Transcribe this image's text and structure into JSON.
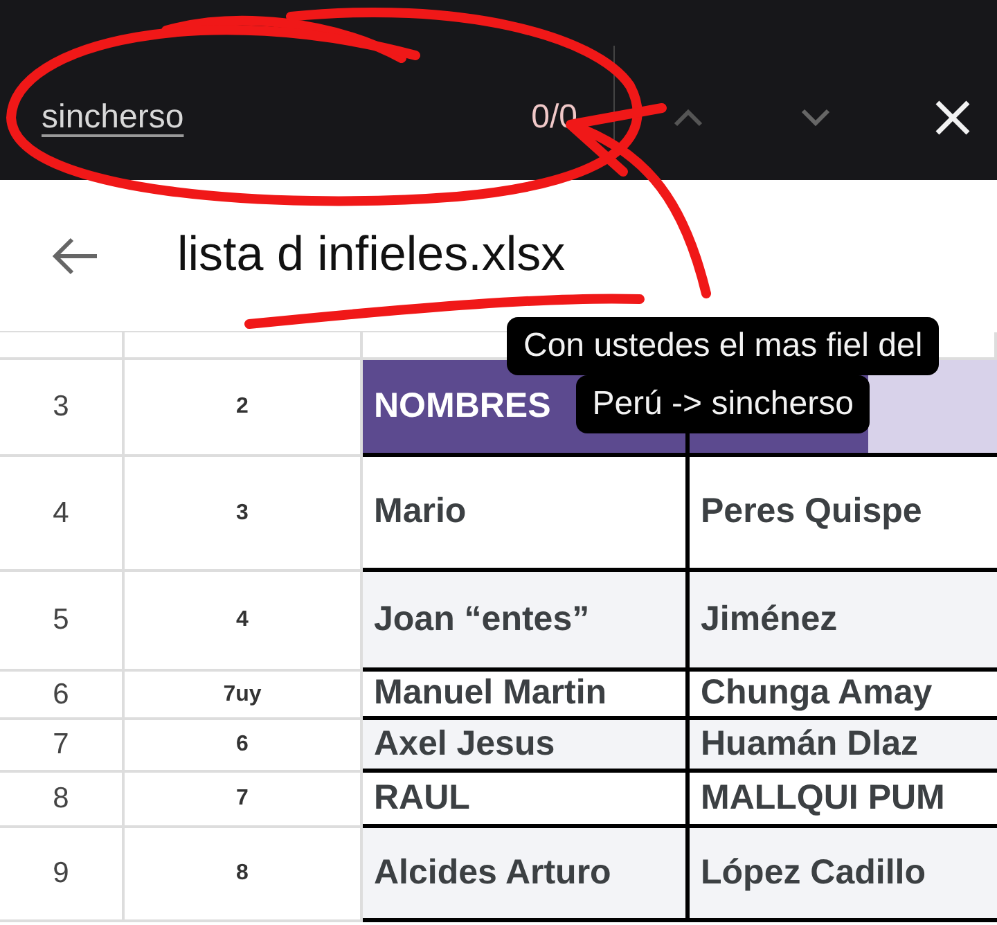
{
  "find_bar": {
    "query": "sincherso",
    "count": "0/0"
  },
  "header": {
    "title": "lista d infieles.xlsx"
  },
  "rows": [
    {
      "number": "3",
      "col_a": "2",
      "kind": "header",
      "col_b": "NOMBRES",
      "shaded": false
    },
    {
      "number": "4",
      "col_a": "3",
      "kind": "data",
      "col_b": "Mario",
      "col_c": "Peres Quispe",
      "shaded": false
    },
    {
      "number": "5",
      "col_a": "4",
      "kind": "data",
      "col_b": "Joan “entes”",
      "col_c": "Jiménez",
      "shaded": true
    },
    {
      "number": "6",
      "col_a": "7uy",
      "kind": "data",
      "col_b": "Manuel Martin",
      "col_c": "Chunga Amay",
      "shaded": false
    },
    {
      "number": "7",
      "col_a": "6",
      "kind": "data",
      "col_b": "Axel Jesus",
      "col_c": "Huamán Dlaz",
      "shaded": true
    },
    {
      "number": "8",
      "col_a": "7",
      "kind": "data",
      "col_b": "RAUL",
      "col_c": "MALLQUI PUM",
      "shaded": false
    },
    {
      "number": "9",
      "col_a": "8",
      "kind": "data",
      "col_b": "Alcides Arturo",
      "col_c": "López Cadillo",
      "shaded": true
    }
  ],
  "caption": [
    "Con ustedes el mas fiel del",
    "Perú -> sincherso"
  ]
}
